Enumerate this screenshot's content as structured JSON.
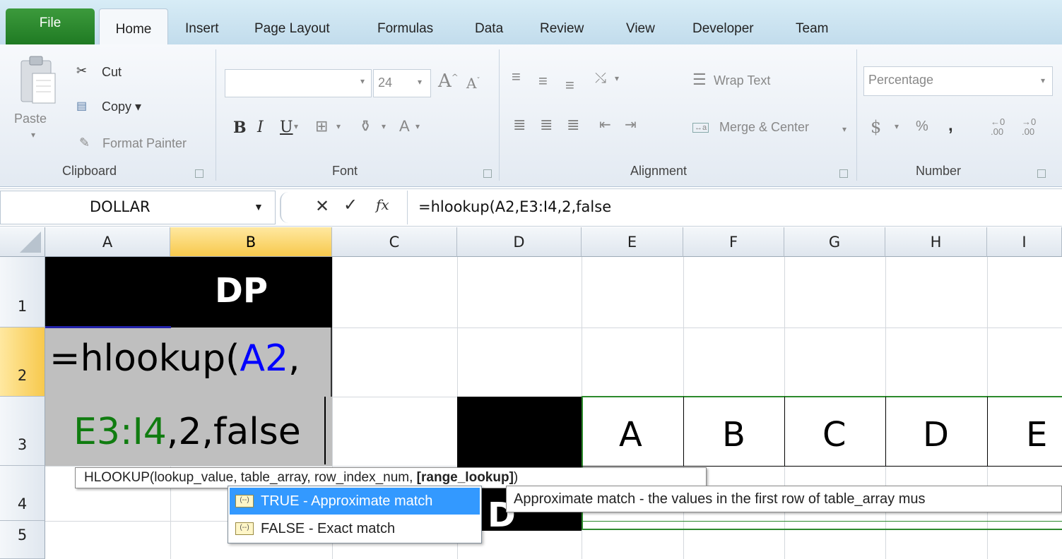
{
  "tabs": {
    "file": "File",
    "home": "Home",
    "insert": "Insert",
    "page_layout": "Page Layout",
    "formulas": "Formulas",
    "data": "Data",
    "review": "Review",
    "view": "View",
    "developer": "Developer",
    "team": "Team"
  },
  "clipboard": {
    "paste": "Paste",
    "cut": "Cut",
    "copy": "Copy ▾",
    "format_painter": "Format Painter",
    "group": "Clipboard"
  },
  "font": {
    "size": "24",
    "bold": "B",
    "italic": "I",
    "underline": "U",
    "font_color": "A",
    "group": "Font"
  },
  "alignment": {
    "wrap_text": "Wrap Text",
    "merge_center": "Merge & Center",
    "group": "Alignment"
  },
  "number": {
    "format": "Percentage",
    "currency": "$",
    "percent": "%",
    "comma": ",",
    "group": "Number"
  },
  "formula_bar": {
    "name_box": "DOLLAR",
    "formula": "=hlookup(A2,E3:I4,2,false"
  },
  "columns": [
    "A",
    "B",
    "C",
    "D",
    "E",
    "F",
    "G",
    "H",
    "I"
  ],
  "rows": [
    "1",
    "2",
    "3",
    "4",
    "5"
  ],
  "cells": {
    "b1": "DP",
    "a2_prefix": "=hlookup(",
    "a2_ref": "A2",
    "a2_suffix": ",",
    "a3_ref": "E3:I4",
    "a3_suffix": ",2,false",
    "e3": "A",
    "f3": "B",
    "g3": "C",
    "h3": "D",
    "i3": "E",
    "d4_partial": "D"
  },
  "function_hint": {
    "prefix": "HLOOKUP(lookup_value, table_array, row_index_num, ",
    "current_arg": "[range_lookup]",
    "suffix": ")"
  },
  "autocomplete": [
    {
      "label": "TRUE - Approximate match",
      "selected": true
    },
    {
      "label": "FALSE - Exact match",
      "selected": false
    }
  ],
  "tooltip": "Approximate match - the values in the first row of table_array mus",
  "colors": {
    "ref_blue": "#0000ff",
    "ref_green": "#107c10",
    "selection_highlight": "#3399ff",
    "header_selected": "#f7c94d",
    "file_tab": "#2a8a2e"
  }
}
